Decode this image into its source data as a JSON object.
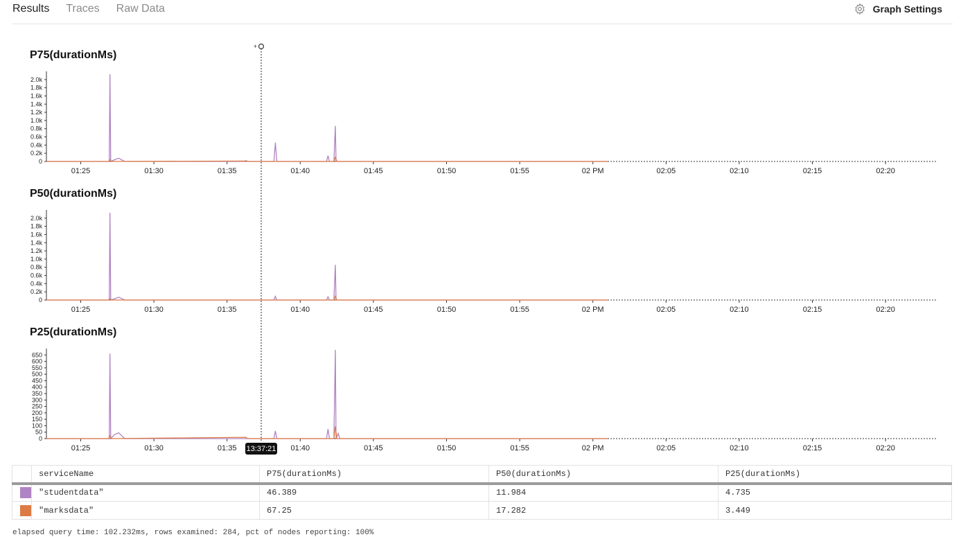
{
  "tabs": [
    {
      "label": "Results",
      "active": true
    },
    {
      "label": "Traces",
      "active": false
    },
    {
      "label": "Raw Data",
      "active": false
    }
  ],
  "graph_settings": {
    "label": "Graph Settings",
    "icon": "gear-icon"
  },
  "cursor": {
    "time_label": "13:37:21"
  },
  "colors": {
    "studentdata": "#b083c4",
    "marksdata": "#dd7b45"
  },
  "chart_data": [
    {
      "type": "line",
      "title": "P75(durationMs)",
      "x_ticks": [
        "01:25",
        "01:30",
        "01:35",
        "01:40",
        "01:45",
        "01:50",
        "01:55",
        "02 PM",
        "02:05",
        "02:10",
        "02:15",
        "02:20"
      ],
      "y_ticks": [
        "0",
        "0.2k",
        "0.4k",
        "0.6k",
        "0.8k",
        "1.0k",
        "1.2k",
        "1.4k",
        "1.6k",
        "1.8k",
        "2.0k"
      ],
      "ylim": [
        0,
        2200
      ],
      "series": [
        {
          "name": "\"studentdata\"",
          "points": [
            [
              -23,
              0
            ],
            [
              -14,
              0
            ],
            [
              -13.05,
              0
            ],
            [
              -13,
              2130
            ],
            [
              -12.95,
              0
            ],
            [
              -12.7,
              40
            ],
            [
              -12.4,
              80
            ],
            [
              -12,
              0
            ],
            [
              -3.8,
              0
            ],
            [
              -3.7,
              20
            ],
            [
              -3.6,
              0
            ],
            [
              -1.8,
              0
            ],
            [
              -1.7,
              460
            ],
            [
              -1.6,
              0
            ],
            [
              1.8,
              0
            ],
            [
              1.9,
              140
            ],
            [
              2.0,
              0
            ],
            [
              2.3,
              0
            ],
            [
              2.4,
              870
            ],
            [
              2.45,
              0
            ],
            [
              2.6,
              0
            ],
            [
              21,
              0
            ]
          ]
        },
        {
          "name": "\"marksdata\"",
          "points": [
            [
              -23,
              0
            ],
            [
              -13.1,
              0
            ],
            [
              -13,
              40
            ],
            [
              -12.9,
              0
            ],
            [
              -3.7,
              10
            ],
            [
              -3.6,
              0
            ],
            [
              2.3,
              0
            ],
            [
              2.4,
              100
            ],
            [
              2.5,
              0
            ],
            [
              21,
              0
            ]
          ]
        }
      ]
    },
    {
      "type": "line",
      "title": "P50(durationMs)",
      "x_ticks": [
        "01:25",
        "01:30",
        "01:35",
        "01:40",
        "01:45",
        "01:50",
        "01:55",
        "02 PM",
        "02:05",
        "02:10",
        "02:15",
        "02:20"
      ],
      "y_ticks": [
        "0",
        "0.2k",
        "0.4k",
        "0.6k",
        "0.8k",
        "1.0k",
        "1.2k",
        "1.4k",
        "1.6k",
        "1.8k",
        "2.0k"
      ],
      "ylim": [
        0,
        2200
      ],
      "series": [
        {
          "name": "\"studentdata\"",
          "points": [
            [
              -23,
              0
            ],
            [
              -13.05,
              0
            ],
            [
              -13,
              2130
            ],
            [
              -12.95,
              0
            ],
            [
              -12.7,
              30
            ],
            [
              -12.4,
              70
            ],
            [
              -12,
              0
            ],
            [
              -1.8,
              0
            ],
            [
              -1.7,
              90
            ],
            [
              -1.6,
              0
            ],
            [
              1.8,
              0
            ],
            [
              1.9,
              80
            ],
            [
              2.0,
              0
            ],
            [
              2.3,
              0
            ],
            [
              2.4,
              860
            ],
            [
              2.45,
              0
            ],
            [
              21,
              0
            ]
          ]
        },
        {
          "name": "\"marksdata\"",
          "points": [
            [
              -23,
              0
            ],
            [
              -13.1,
              0
            ],
            [
              -13,
              30
            ],
            [
              -12.9,
              0
            ],
            [
              2.3,
              0
            ],
            [
              2.4,
              90
            ],
            [
              2.5,
              0
            ],
            [
              21,
              0
            ]
          ]
        }
      ]
    },
    {
      "type": "line",
      "title": "P25(durationMs)",
      "x_ticks": [
        "01:25",
        "01:30",
        "01:35",
        "01:40",
        "01:45",
        "01:50",
        "01:55",
        "02 PM",
        "02:05",
        "02:10",
        "02:15",
        "02:20"
      ],
      "y_ticks": [
        "0",
        "50",
        "100",
        "150",
        "200",
        "250",
        "300",
        "350",
        "400",
        "450",
        "500",
        "550",
        "600",
        "650"
      ],
      "ylim": [
        0,
        700
      ],
      "series": [
        {
          "name": "\"studentdata\"",
          "points": [
            [
              -23,
              0
            ],
            [
              -13.05,
              0
            ],
            [
              -13,
              660
            ],
            [
              -12.95,
              0
            ],
            [
              -12.7,
              30
            ],
            [
              -12.4,
              45
            ],
            [
              -12,
              0
            ],
            [
              -1.8,
              0
            ],
            [
              -1.7,
              60
            ],
            [
              -1.6,
              0
            ],
            [
              1.8,
              0
            ],
            [
              1.9,
              75
            ],
            [
              2.0,
              0
            ],
            [
              2.3,
              0
            ],
            [
              2.4,
              690
            ],
            [
              2.45,
              0
            ],
            [
              2.6,
              40
            ],
            [
              2.7,
              0
            ],
            [
              21,
              0
            ]
          ]
        },
        {
          "name": "\"marksdata\"",
          "points": [
            [
              -23,
              0
            ],
            [
              -13.1,
              0
            ],
            [
              -13,
              20
            ],
            [
              -12.9,
              0
            ],
            [
              -3.7,
              10
            ],
            [
              -3.6,
              0
            ],
            [
              2.3,
              0
            ],
            [
              2.4,
              95
            ],
            [
              2.5,
              0
            ],
            [
              21,
              0
            ]
          ]
        }
      ]
    }
  ],
  "table": {
    "headers": [
      "serviceName",
      "P75(durationMs)",
      "P50(durationMs)",
      "P25(durationMs)"
    ],
    "rows": [
      {
        "service": "\"studentdata\"",
        "color": "#b083c4",
        "p75": "46.389",
        "p50": "11.984",
        "p25": "4.735"
      },
      {
        "service": "\"marksdata\"",
        "color": "#dd7b45",
        "p75": "67.25",
        "p50": "17.282",
        "p25": "3.449"
      }
    ]
  },
  "footer": "elapsed query time: 102.232ms, rows examined: 284, pct of nodes reporting: 100%"
}
